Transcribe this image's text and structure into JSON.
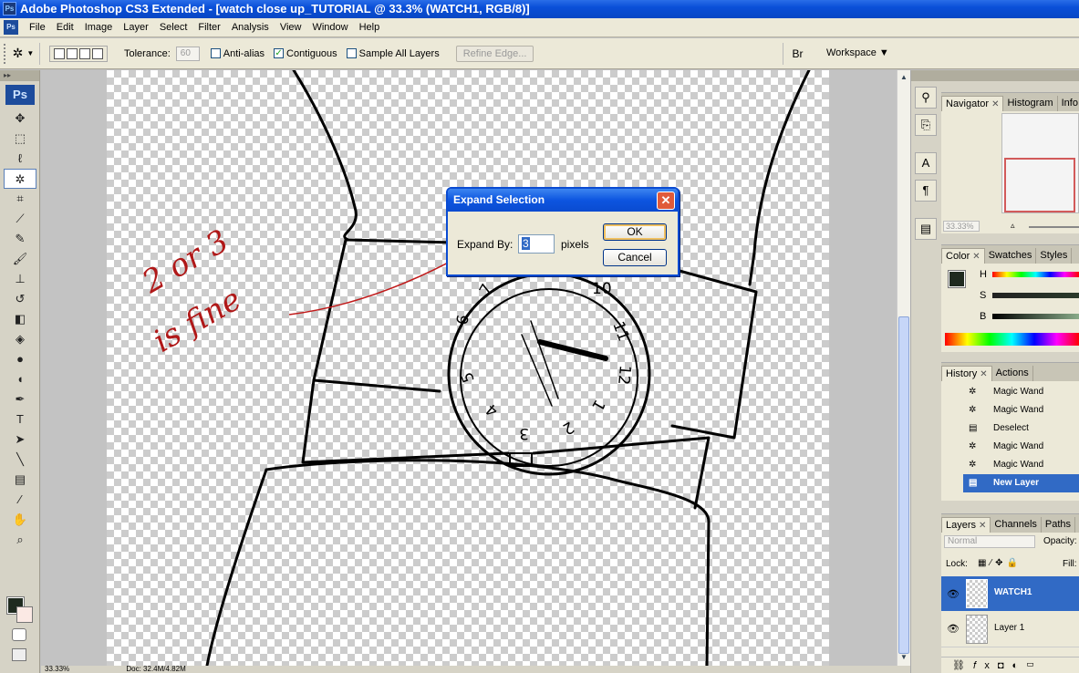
{
  "window": {
    "title": "Adobe Photoshop CS3 Extended - [watch close up_TUTORIAL @ 33.3% (WATCH1, RGB/8)]",
    "app_icon": "Ps"
  },
  "menu": [
    "File",
    "Edit",
    "Image",
    "Layer",
    "Select",
    "Filter",
    "Analysis",
    "View",
    "Window",
    "Help"
  ],
  "options": {
    "tolerance_label": "Tolerance:",
    "tolerance_value": "60",
    "anti_alias": {
      "label": "Anti-alias",
      "checked": false
    },
    "contiguous": {
      "label": "Contiguous",
      "checked": true
    },
    "sample_all": {
      "label": "Sample All Layers",
      "checked": false
    },
    "refine_edge": "Refine Edge...",
    "workspace": "Workspace ▼"
  },
  "tools": {
    "ps_label": "Ps",
    "icons": [
      "move-icon",
      "marquee-icon",
      "lasso-icon",
      "magic-wand-icon",
      "crop-icon",
      "eyedropper-icon",
      "healing-brush-icon",
      "brush-icon",
      "clone-stamp-icon",
      "history-brush-icon",
      "eraser-icon",
      "paint-bucket-icon",
      "blur-icon",
      "dodge-icon",
      "pen-icon",
      "type-icon",
      "path-select-icon",
      "line-icon",
      "notes-icon",
      "eyedropper2-icon",
      "hand-icon",
      "zoom-icon"
    ]
  },
  "canvas": {
    "annotation_line1": "2 or 3",
    "annotation_line2": "is fine",
    "watch_numbers": [
      "11",
      "12",
      "1",
      "2",
      "3",
      "4",
      "5",
      "6",
      "7",
      "10"
    ]
  },
  "dialog": {
    "title": "Expand Selection",
    "label": "Expand By:",
    "value": "3",
    "unit": "pixels",
    "ok": "OK",
    "cancel": "Cancel"
  },
  "status": {
    "zoom": "33.33%",
    "doc": "Doc: 32.4M/4.82M"
  },
  "navigator": {
    "tabs": [
      "Navigator",
      "Histogram",
      "Info"
    ],
    "zoom": "33.33%"
  },
  "color": {
    "tabs": [
      "Color",
      "Swatches",
      "Styles"
    ],
    "channels": [
      "H",
      "S",
      "B"
    ],
    "accent": "#1f2a1f"
  },
  "history": {
    "tabs": [
      "History",
      "Actions"
    ],
    "items": [
      {
        "label": "Magic Wand",
        "icon": "magic-wand-icon"
      },
      {
        "label": "Magic Wand",
        "icon": "magic-wand-icon"
      },
      {
        "label": "Deselect",
        "icon": "document-icon"
      },
      {
        "label": "Magic Wand",
        "icon": "magic-wand-icon"
      },
      {
        "label": "Magic Wand",
        "icon": "magic-wand-icon"
      },
      {
        "label": "New Layer",
        "icon": "document-icon",
        "selected": true
      }
    ]
  },
  "layers": {
    "tabs": [
      "Layers",
      "Channels",
      "Paths"
    ],
    "blend_mode": "Normal",
    "opacity_label": "Opacity:",
    "lock_label": "Lock:",
    "fill_label": "Fill:",
    "items": [
      {
        "name": "WATCH1",
        "selected": true
      },
      {
        "name": "Layer 1",
        "selected": false
      }
    ]
  }
}
